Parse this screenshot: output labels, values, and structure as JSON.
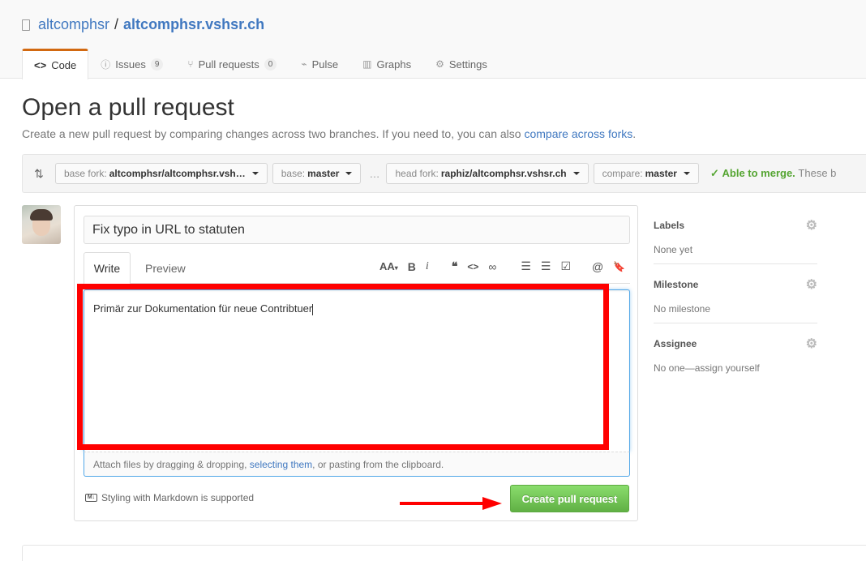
{
  "repo": {
    "owner": "altcomphsr",
    "separator": "/",
    "name": "altcomphsr.vshsr.ch"
  },
  "tabs": [
    {
      "label": "Code",
      "icon": "code-icon",
      "counter": ""
    },
    {
      "label": "Issues",
      "icon": "issue-icon",
      "counter": "9"
    },
    {
      "label": "Pull requests",
      "icon": "pull-request-icon",
      "counter": "0"
    },
    {
      "label": "Pulse",
      "icon": "pulse-icon",
      "counter": ""
    },
    {
      "label": "Graphs",
      "icon": "graph-icon",
      "counter": ""
    },
    {
      "label": "Settings",
      "icon": "gear-icon",
      "counter": ""
    }
  ],
  "page": {
    "title": "Open a pull request",
    "subtitle_prefix": "Create a new pull request by comparing changes across two branches. If you need to, you can also ",
    "subtitle_link": "compare across forks",
    "subtitle_suffix": "."
  },
  "range": {
    "base_fork_label": "base fork:",
    "base_fork_value": "altcomphsr/altcomphsr.vsh…",
    "base_label": "base:",
    "base_value": "master",
    "dots": "…",
    "head_fork_label": "head fork:",
    "head_fork_value": "raphiz/altcomphsr.vshsr.ch",
    "compare_label": "compare:",
    "compare_value": "master",
    "merge_status": "Able to merge.",
    "merge_note": "These b"
  },
  "form": {
    "title_value": "Fix typo in URL to statuten",
    "write_tab": "Write",
    "preview_tab": "Preview",
    "body_text": "Primär zur Dokumentation für neue Contribtuer",
    "attach_prefix": "Attach files by dragging & dropping, ",
    "attach_link": "selecting them",
    "attach_suffix": ", or pasting from the clipboard.",
    "markdown_note": "Styling with Markdown is supported",
    "markdown_icon": "M↓",
    "submit_label": "Create pull request"
  },
  "toolbar": {
    "header": "AA",
    "bold": "B",
    "italic": "i",
    "quote": "❝",
    "code": "<>",
    "link": "∞",
    "ul": "☰",
    "ol": "☰",
    "tasks": "☑",
    "mention": "@",
    "reference": "🔖"
  },
  "sidebar": {
    "labels_title": "Labels",
    "labels_value": "None yet",
    "milestone_title": "Milestone",
    "milestone_value": "No milestone",
    "assignee_title": "Assignee",
    "assignee_value": "No one—assign yourself"
  },
  "colors": {
    "merge_green": "#55a532",
    "button_green": "#60b044",
    "annotation_red": "#ff0000",
    "link_blue": "#4078c0",
    "tab_accent": "#d26911"
  }
}
